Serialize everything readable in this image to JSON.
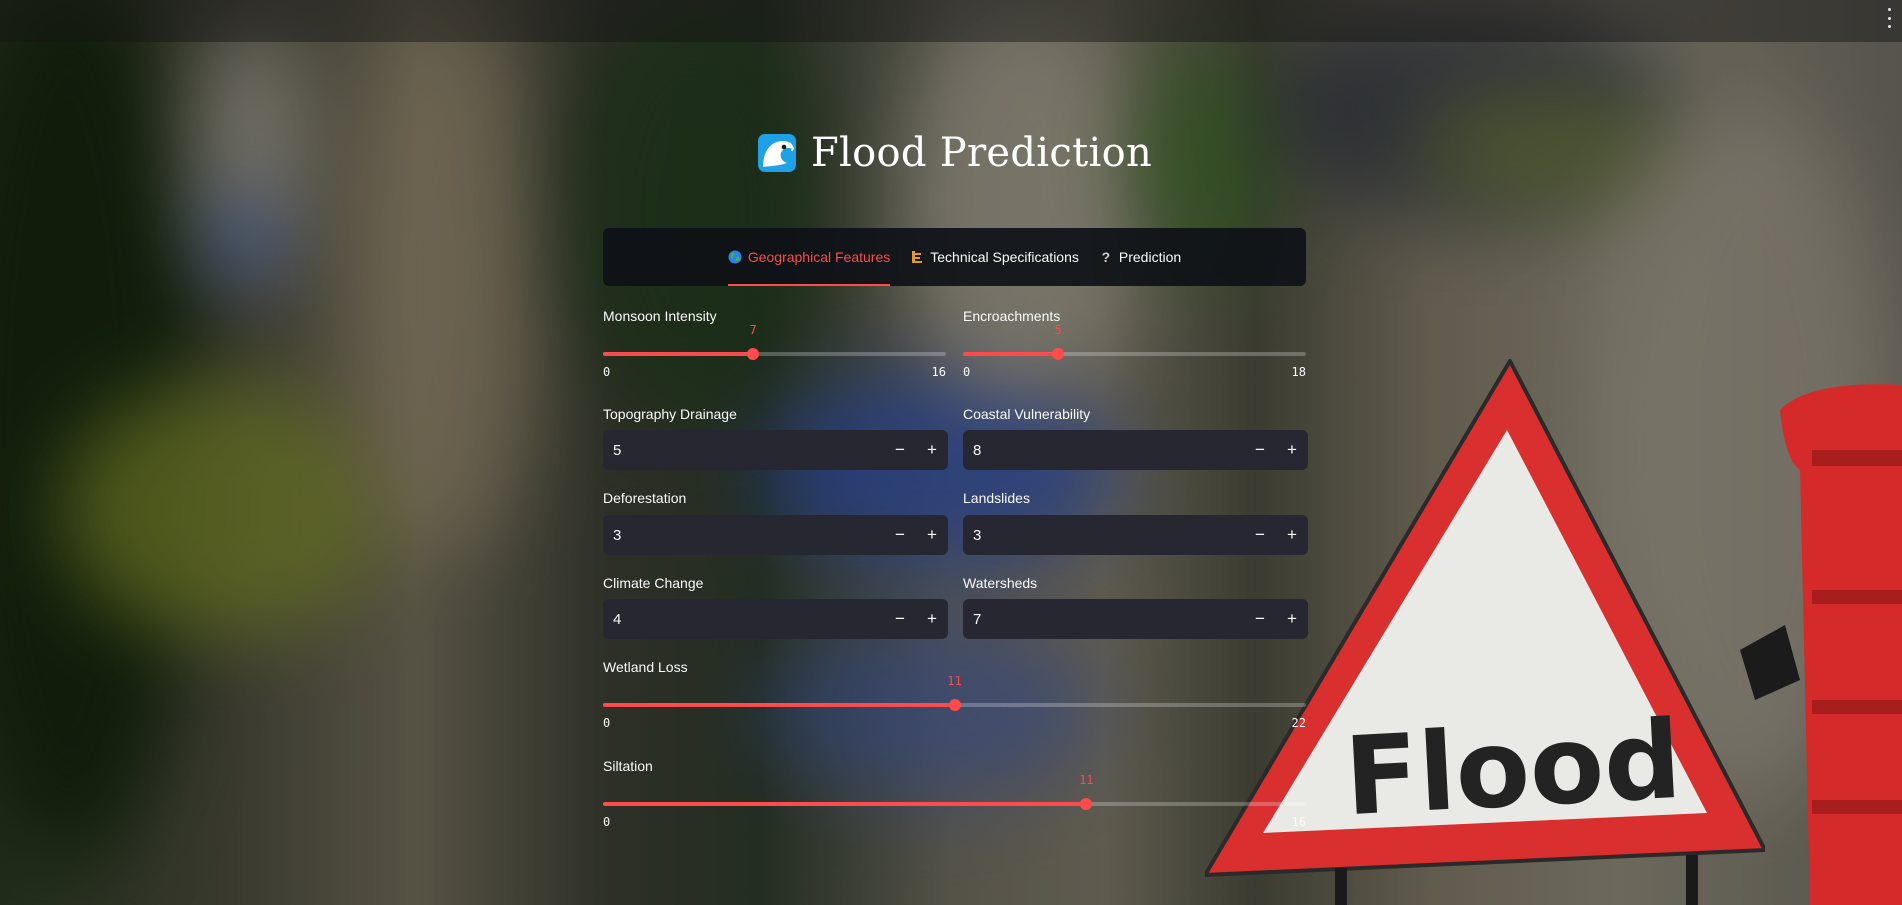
{
  "app": {
    "title": "Flood Prediction",
    "accent_color": "#ff4b4b",
    "background_image": "blurred flooded street with red triangular Flood warning sign"
  },
  "background_sign": {
    "text": "Flood"
  },
  "header": {
    "menu_icon": "vertical-dots-icon"
  },
  "tabs": [
    {
      "label": "Geographical Features",
      "icon": "globe-icon",
      "active": true
    },
    {
      "label": "Technical Specifications",
      "icon": "building-icon",
      "active": false
    },
    {
      "label": "Prediction",
      "icon": "question-icon",
      "active": false
    }
  ],
  "fields": {
    "monsoon_intensity": {
      "label": "Monsoon Intensity",
      "value": 7,
      "min": 0,
      "max": 16
    },
    "encroachments": {
      "label": "Encroachments",
      "value": 5,
      "min": 0,
      "max": 18
    },
    "topography_drainage": {
      "label": "Topography Drainage",
      "value": "5"
    },
    "coastal_vulnerability": {
      "label": "Coastal Vulnerability",
      "value": "8"
    },
    "deforestation": {
      "label": "Deforestation",
      "value": "3"
    },
    "landslides": {
      "label": "Landslides",
      "value": "3"
    },
    "climate_change": {
      "label": "Climate Change",
      "value": "4"
    },
    "watersheds": {
      "label": "Watersheds",
      "value": "7"
    },
    "wetland_loss": {
      "label": "Wetland Loss",
      "value": 11,
      "min": 0,
      "max": 22
    },
    "siltation": {
      "label": "Siltation",
      "value": 11,
      "min": 0,
      "max": 16
    }
  },
  "stepper": {
    "minus": "−",
    "plus": "+"
  }
}
